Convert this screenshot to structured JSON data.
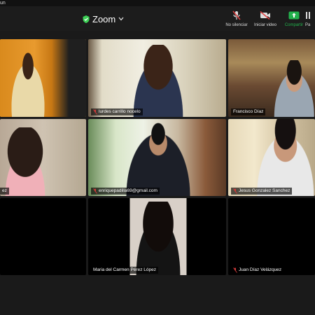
{
  "window": {
    "title_fragment": "un"
  },
  "header": {
    "title": "Zoom",
    "buttons": {
      "unmute": "No silenciar",
      "start_video": "Iniciar video",
      "share": "Compartir",
      "partial": "Pa"
    }
  },
  "participants": [
    {
      "name": ""
    },
    {
      "name": "lurdes carrillo nocelo"
    },
    {
      "name": "Francisco Díaz"
    },
    {
      "name": "ez"
    },
    {
      "name": "enriquepadilla69@gmail.com"
    },
    {
      "name": "Jesus Gonzalez Sanchez"
    },
    {
      "name": ""
    },
    {
      "name": "Maria del Carmen Pérez López"
    },
    {
      "name": "Juan Díaz Velázquez"
    }
  ],
  "colors": {
    "active_speaker": "#f0a43a",
    "share_green": "#22b14c",
    "muted_red": "#d03a3a",
    "shield_green": "#3ccf55"
  }
}
